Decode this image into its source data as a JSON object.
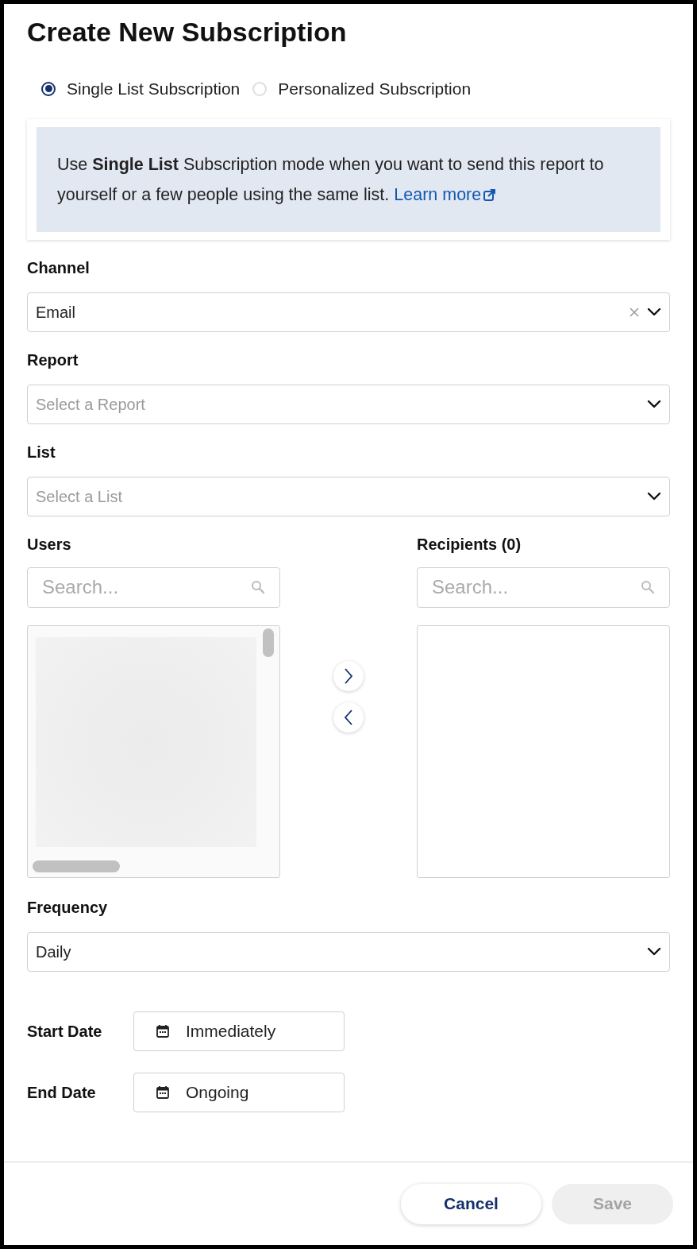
{
  "title": "Create New Subscription",
  "modes": [
    {
      "label": "Single List Subscription",
      "selected": true
    },
    {
      "label": "Personalized Subscription",
      "selected": false
    }
  ],
  "info": {
    "text": "Use **Single List** Subscription mode when you want to send this report to yourself or a few people using the same list.",
    "link": "Learn more"
  },
  "channel": {
    "label": "Channel",
    "value": "Email",
    "clearable": true
  },
  "report": {
    "label": "Report",
    "placeholder": "Select a Report"
  },
  "list": {
    "label": "List",
    "placeholder": "Select a List"
  },
  "users": {
    "label": "Users",
    "search_placeholder": "Search..."
  },
  "recipients": {
    "label": "Recipients (0)",
    "search_placeholder": "Search..."
  },
  "frequency": {
    "label": "Frequency",
    "value": "Daily"
  },
  "dates": [
    {
      "label": "Start Date",
      "value": "Immediately"
    },
    {
      "label": "End Date",
      "value": "Ongoing"
    }
  ],
  "buttons": [
    {
      "label": "Cancel",
      "disabled": false
    },
    {
      "label": "Save",
      "disabled": true
    }
  ]
}
